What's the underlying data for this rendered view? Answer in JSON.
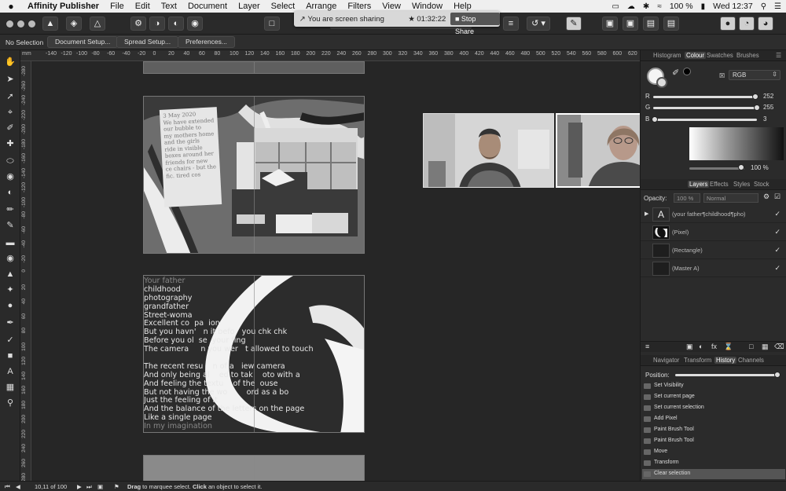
{
  "menubar": {
    "apple": "",
    "items": [
      "Affinity Publisher",
      "File",
      "Edit",
      "Text",
      "Document",
      "Layer",
      "Select",
      "Arrange",
      "Filters",
      "View",
      "Window",
      "Help"
    ],
    "battery": "100 %",
    "clock": "Wed 12:37"
  },
  "share": {
    "message": "You are screen sharing",
    "timer": "01:32:22",
    "stop_label": "Stop Share"
  },
  "context": {
    "selection": "No Selection",
    "document_setup": "Document Setup...",
    "spread_setup": "Spread Setup...",
    "preferences": "Preferences..."
  },
  "ruler": {
    "unit": "mm",
    "h_ticks": [
      "-140",
      "-120",
      "-100",
      "-80",
      "-60",
      "-40",
      "-20",
      "0",
      "20",
      "40",
      "60",
      "80",
      "100",
      "120",
      "140",
      "160",
      "180",
      "200",
      "220",
      "240",
      "260",
      "280",
      "300",
      "320",
      "340",
      "360",
      "380",
      "400",
      "420",
      "440",
      "460",
      "480",
      "500",
      "520",
      "540",
      "560",
      "580",
      "600",
      "620",
      "640",
      "660"
    ],
    "v_ticks": [
      "-280",
      "-260",
      "-240",
      "-220",
      "-200",
      "-180",
      "-160",
      "-140",
      "-120",
      "-100",
      "-80",
      "-60",
      "-40",
      "-20",
      "0",
      "20",
      "40",
      "60",
      "80",
      "100",
      "120",
      "140",
      "160",
      "180",
      "200",
      "220",
      "240",
      "260",
      "280"
    ]
  },
  "page2": {
    "note_lines": [
      "3 May 2020",
      "We have extended",
      "our bubble to",
      "my mothers home",
      "and the girls",
      "ride in visible",
      "boxes around her",
      "friends for new",
      "ce chairs - but the",
      "fic. tired cos"
    ]
  },
  "page3": {
    "poem": [
      {
        "text": "Your father",
        "dim": true
      },
      {
        "text": "childhood",
        "dim": false
      },
      {
        "text": "photography",
        "dim": false
      },
      {
        "text": "grandfather",
        "dim": false
      },
      {
        "text": "Street-woma",
        "dim": false
      },
      {
        "text": "Excellent co  pa  ion",
        "dim": false
      },
      {
        "text": "But you havn'   n it befo   you chk chk",
        "dim": false
      },
      {
        "text": "Before you ol  se  your fing",
        "dim": false
      },
      {
        "text": "The camera     n you wer   t allowed to touch",
        "dim": false
      },
      {
        "text": "",
        "dim": false
      },
      {
        "text": "The recent resu    n of a   iew camera",
        "dim": false
      },
      {
        "text": "And only being al    ed to tak    oto with a",
        "dim": false
      },
      {
        "text": "And feeling the textu    of the  ouse",
        "dim": false
      },
      {
        "text": "But not having the wo        ord as a bo",
        "dim": false
      },
      {
        "text": "Just the feeling of it",
        "dim": false
      },
      {
        "text": "And the balance of the letters on the page",
        "dim": false
      },
      {
        "text": "Like a single page",
        "dim": false
      },
      {
        "text": "In my imagination",
        "dim": true
      }
    ]
  },
  "colour_panel": {
    "tabs": [
      "Histogram",
      "Colour",
      "Swatches",
      "Brushes"
    ],
    "active_tab": "Colour",
    "mode": "RGB",
    "r_label": "R",
    "r_value": "252",
    "g_label": "G",
    "g_value": "255",
    "b_label": "B",
    "b_value": "3",
    "r_fraction": 0.988,
    "g_fraction": 1.0,
    "b_fraction": 0.012,
    "opacity": "100 %"
  },
  "layers_panel": {
    "tabs": [
      "Layers",
      "Effects",
      "Styles",
      "Stock"
    ],
    "active_tab": "Layers",
    "opacity_label": "Opacity:",
    "opacity_value": "100 %",
    "blend_mode": "Normal",
    "layers": [
      {
        "name": "(your father¶childhood¶pho)",
        "thumb": "A"
      },
      {
        "name": "(Pixel)",
        "thumb": ""
      },
      {
        "name": "(Rectangle)",
        "thumb": ""
      },
      {
        "name": "(Master A)",
        "thumb": ""
      }
    ]
  },
  "history_panel": {
    "tabs": [
      "Navigator",
      "Transform",
      "History",
      "Channels"
    ],
    "active_tab": "History",
    "position_label": "Position:",
    "items": [
      "Set Visibility",
      "Set current page",
      "Set current selection",
      "Add Pixel",
      "Paint Brush Tool",
      "Paint Brush Tool",
      "Move",
      "Transform",
      "Clear selection"
    ],
    "current_index": 8
  },
  "status": {
    "page": "10,11 of 100",
    "hint_bold1": "Drag",
    "hint1": " to marquee select. ",
    "hint_bold2": "Click",
    "hint2": " an object to select it."
  }
}
